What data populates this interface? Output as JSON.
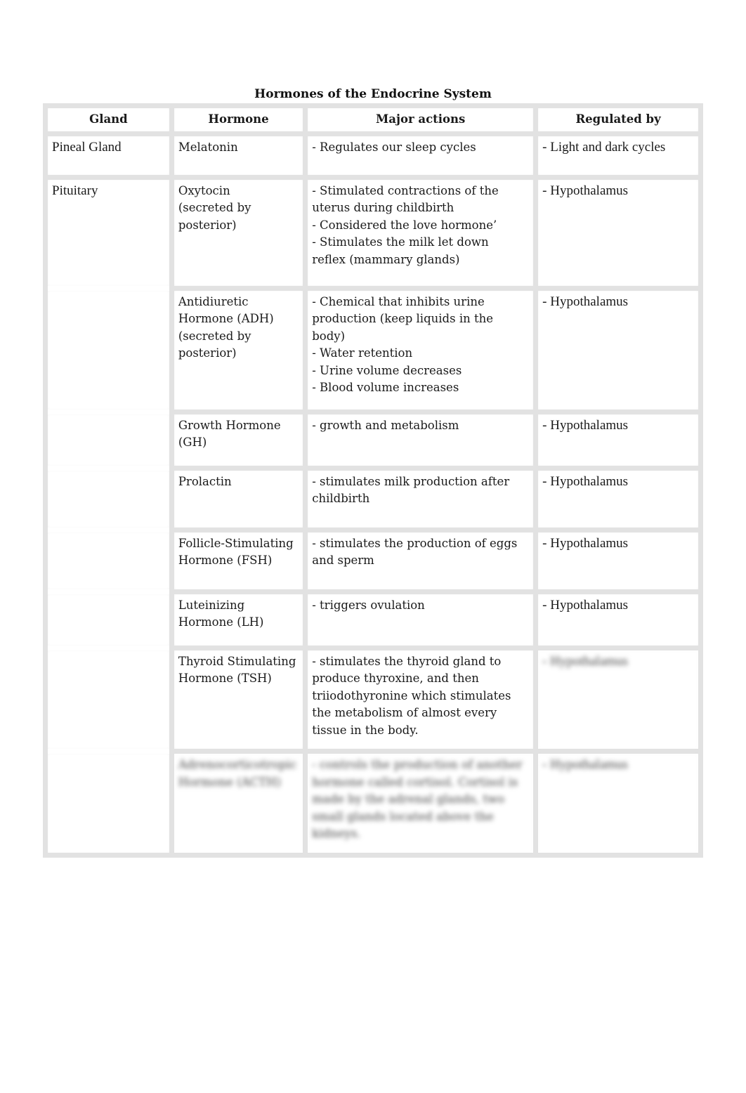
{
  "document": {
    "title": "Hormones of the Endocrine System",
    "headers": {
      "gland": "Gland",
      "hormone": "Hormone",
      "actions": "Major actions",
      "regulated_by": "Regulated by"
    },
    "rows": [
      {
        "gland": "Pineal Gland",
        "hormone": [
          "Melatonin"
        ],
        "actions": [
          "- Regulates our sleep cycles"
        ],
        "regulated_by": "- Light and dark cycles"
      },
      {
        "gland": "Pituitary",
        "hormone": [
          "Oxytocin",
          "(secreted by",
          "posterior)"
        ],
        "actions": [
          "- Stimulated contractions of the",
          "uterus during childbirth",
          "- Considered the love hormone’",
          "- Stimulates the milk let down",
          "reflex (mammary glands)"
        ],
        "regulated_by": "- Hypothalamus"
      },
      {
        "gland": "",
        "hormone": [
          "Antidiuretic",
          "Hormone (ADH)",
          "(secreted by",
          "posterior)"
        ],
        "actions": [
          "- Chemical that inhibits urine",
          "production (keep liquids in the",
          "body)",
          "- Water retention",
          "- Urine volume decreases",
          "- Blood volume increases"
        ],
        "regulated_by": "- Hypothalamus"
      },
      {
        "gland": "",
        "hormone": [
          "Growth Hormone",
          "(GH)"
        ],
        "actions": [
          "- growth and metabolism"
        ],
        "regulated_by": "- Hypothalamus"
      },
      {
        "gland": "",
        "hormone": [
          "Prolactin"
        ],
        "actions": [
          "- stimulates milk production after",
          "childbirth"
        ],
        "regulated_by": "- Hypothalamus"
      },
      {
        "gland": "",
        "hormone": [
          "Follicle-Stimulating",
          "Hormone (FSH)"
        ],
        "actions": [
          "- stimulates the production of eggs",
          "and sperm"
        ],
        "regulated_by": "- Hypothalamus"
      },
      {
        "gland": "",
        "hormone": [
          "Luteinizing",
          "Hormone (LH)"
        ],
        "actions": [
          "- triggers ovulation"
        ],
        "regulated_by": "- Hypothalamus"
      },
      {
        "gland": "",
        "hormone": [
          "Thyroid Stimulating",
          "Hormone (TSH)"
        ],
        "actions": [
          "- stimulates the thyroid gland to",
          "produce thyroxine, and then",
          "triiodothyronine which stimulates",
          "the metabolism of almost every",
          "tissue in the body."
        ],
        "regulated_by": "- Hypothalamus",
        "regulated_blurred": true
      },
      {
        "gland": "",
        "hormone": [
          "Adrenocorticotropic",
          "Hormone (ACTH)"
        ],
        "actions": [
          "- controls the production of another",
          "hormone called cortisol. Cortisol is",
          "made by the adrenal glands, two",
          "small glands located above the",
          "kidneys."
        ],
        "regulated_by": "- Hypothalamus",
        "blurred": true
      }
    ]
  }
}
